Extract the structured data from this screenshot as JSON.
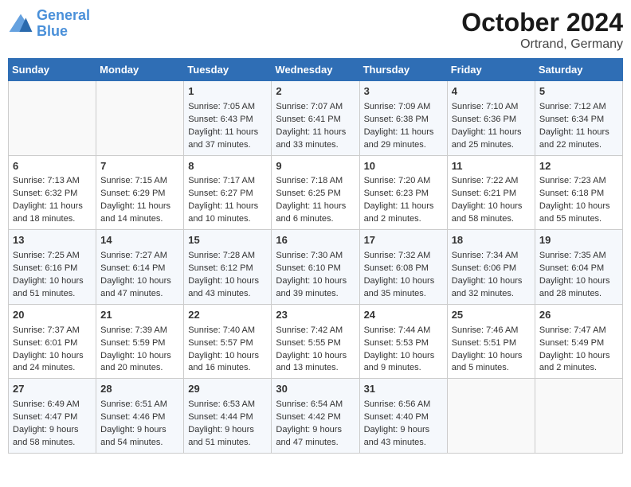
{
  "header": {
    "logo_line1": "General",
    "logo_line2": "Blue",
    "month": "October 2024",
    "location": "Ortrand, Germany"
  },
  "weekdays": [
    "Sunday",
    "Monday",
    "Tuesday",
    "Wednesday",
    "Thursday",
    "Friday",
    "Saturday"
  ],
  "weeks": [
    [
      {
        "day": "",
        "info": ""
      },
      {
        "day": "",
        "info": ""
      },
      {
        "day": "1",
        "info": "Sunrise: 7:05 AM\nSunset: 6:43 PM\nDaylight: 11 hours\nand 37 minutes."
      },
      {
        "day": "2",
        "info": "Sunrise: 7:07 AM\nSunset: 6:41 PM\nDaylight: 11 hours\nand 33 minutes."
      },
      {
        "day": "3",
        "info": "Sunrise: 7:09 AM\nSunset: 6:38 PM\nDaylight: 11 hours\nand 29 minutes."
      },
      {
        "day": "4",
        "info": "Sunrise: 7:10 AM\nSunset: 6:36 PM\nDaylight: 11 hours\nand 25 minutes."
      },
      {
        "day": "5",
        "info": "Sunrise: 7:12 AM\nSunset: 6:34 PM\nDaylight: 11 hours\nand 22 minutes."
      }
    ],
    [
      {
        "day": "6",
        "info": "Sunrise: 7:13 AM\nSunset: 6:32 PM\nDaylight: 11 hours\nand 18 minutes."
      },
      {
        "day": "7",
        "info": "Sunrise: 7:15 AM\nSunset: 6:29 PM\nDaylight: 11 hours\nand 14 minutes."
      },
      {
        "day": "8",
        "info": "Sunrise: 7:17 AM\nSunset: 6:27 PM\nDaylight: 11 hours\nand 10 minutes."
      },
      {
        "day": "9",
        "info": "Sunrise: 7:18 AM\nSunset: 6:25 PM\nDaylight: 11 hours\nand 6 minutes."
      },
      {
        "day": "10",
        "info": "Sunrise: 7:20 AM\nSunset: 6:23 PM\nDaylight: 11 hours\nand 2 minutes."
      },
      {
        "day": "11",
        "info": "Sunrise: 7:22 AM\nSunset: 6:21 PM\nDaylight: 10 hours\nand 58 minutes."
      },
      {
        "day": "12",
        "info": "Sunrise: 7:23 AM\nSunset: 6:18 PM\nDaylight: 10 hours\nand 55 minutes."
      }
    ],
    [
      {
        "day": "13",
        "info": "Sunrise: 7:25 AM\nSunset: 6:16 PM\nDaylight: 10 hours\nand 51 minutes."
      },
      {
        "day": "14",
        "info": "Sunrise: 7:27 AM\nSunset: 6:14 PM\nDaylight: 10 hours\nand 47 minutes."
      },
      {
        "day": "15",
        "info": "Sunrise: 7:28 AM\nSunset: 6:12 PM\nDaylight: 10 hours\nand 43 minutes."
      },
      {
        "day": "16",
        "info": "Sunrise: 7:30 AM\nSunset: 6:10 PM\nDaylight: 10 hours\nand 39 minutes."
      },
      {
        "day": "17",
        "info": "Sunrise: 7:32 AM\nSunset: 6:08 PM\nDaylight: 10 hours\nand 35 minutes."
      },
      {
        "day": "18",
        "info": "Sunrise: 7:34 AM\nSunset: 6:06 PM\nDaylight: 10 hours\nand 32 minutes."
      },
      {
        "day": "19",
        "info": "Sunrise: 7:35 AM\nSunset: 6:04 PM\nDaylight: 10 hours\nand 28 minutes."
      }
    ],
    [
      {
        "day": "20",
        "info": "Sunrise: 7:37 AM\nSunset: 6:01 PM\nDaylight: 10 hours\nand 24 minutes."
      },
      {
        "day": "21",
        "info": "Sunrise: 7:39 AM\nSunset: 5:59 PM\nDaylight: 10 hours\nand 20 minutes."
      },
      {
        "day": "22",
        "info": "Sunrise: 7:40 AM\nSunset: 5:57 PM\nDaylight: 10 hours\nand 16 minutes."
      },
      {
        "day": "23",
        "info": "Sunrise: 7:42 AM\nSunset: 5:55 PM\nDaylight: 10 hours\nand 13 minutes."
      },
      {
        "day": "24",
        "info": "Sunrise: 7:44 AM\nSunset: 5:53 PM\nDaylight: 10 hours\nand 9 minutes."
      },
      {
        "day": "25",
        "info": "Sunrise: 7:46 AM\nSunset: 5:51 PM\nDaylight: 10 hours\nand 5 minutes."
      },
      {
        "day": "26",
        "info": "Sunrise: 7:47 AM\nSunset: 5:49 PM\nDaylight: 10 hours\nand 2 minutes."
      }
    ],
    [
      {
        "day": "27",
        "info": "Sunrise: 6:49 AM\nSunset: 4:47 PM\nDaylight: 9 hours\nand 58 minutes."
      },
      {
        "day": "28",
        "info": "Sunrise: 6:51 AM\nSunset: 4:46 PM\nDaylight: 9 hours\nand 54 minutes."
      },
      {
        "day": "29",
        "info": "Sunrise: 6:53 AM\nSunset: 4:44 PM\nDaylight: 9 hours\nand 51 minutes."
      },
      {
        "day": "30",
        "info": "Sunrise: 6:54 AM\nSunset: 4:42 PM\nDaylight: 9 hours\nand 47 minutes."
      },
      {
        "day": "31",
        "info": "Sunrise: 6:56 AM\nSunset: 4:40 PM\nDaylight: 9 hours\nand 43 minutes."
      },
      {
        "day": "",
        "info": ""
      },
      {
        "day": "",
        "info": ""
      }
    ]
  ]
}
